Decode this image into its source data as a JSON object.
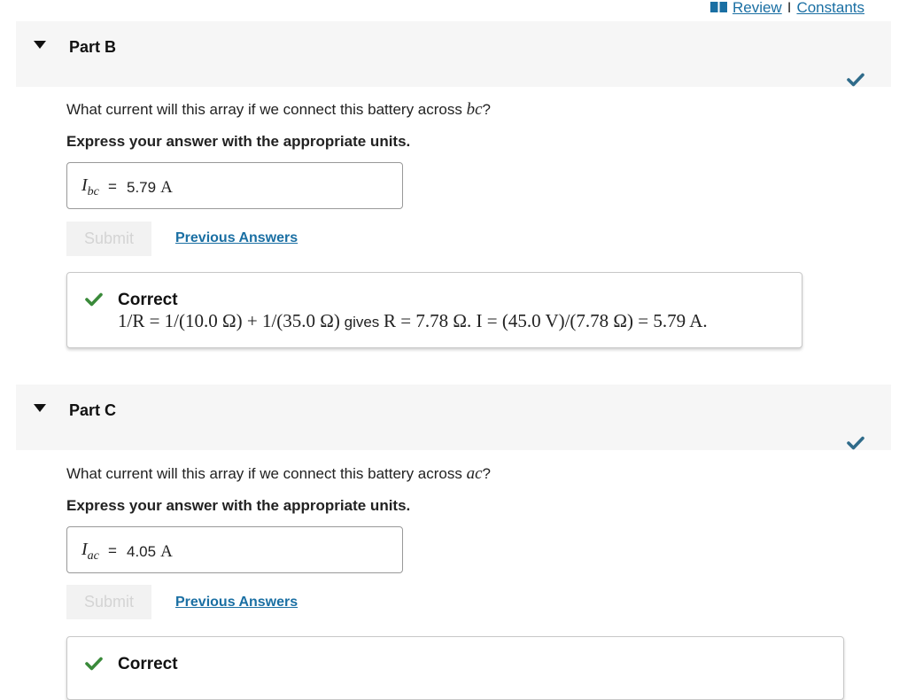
{
  "topbar": {
    "review": "Review",
    "separator": "I",
    "constants": "Constants"
  },
  "colors": {
    "link": "#1a6fa3",
    "check": "#2f6b8a",
    "correct": "#3a8a3a"
  },
  "part_b": {
    "title": "Part B",
    "question_prefix": "What current will this array if we connect this battery across ",
    "question_var": "bc",
    "question_suffix": "?",
    "instruction": "Express your answer with the appropriate units.",
    "answer_label": "I",
    "answer_sub": "bc",
    "equals": "=",
    "answer_value": "5.79",
    "answer_unit": "A",
    "submit": "Submit",
    "previous": "Previous Answers",
    "feedback_title": "Correct",
    "feedback_math1": "1/R = 1/(10.0 Ω) + 1/(35.0 Ω)",
    "feedback_word": " gives ",
    "feedback_math2": "R = 7.78 Ω. I = (45.0 V)/(7.78 Ω) = 5.79 A."
  },
  "part_c": {
    "title": "Part C",
    "question_prefix": "What current will this array if we connect this battery across ",
    "question_var": "ac",
    "question_suffix": "?",
    "instruction": "Express your answer with the appropriate units.",
    "answer_label": "I",
    "answer_sub": "ac",
    "equals": "=",
    "answer_value": "4.05",
    "answer_unit": "A",
    "submit": "Submit",
    "previous": "Previous Answers",
    "feedback_title": "Correct"
  }
}
